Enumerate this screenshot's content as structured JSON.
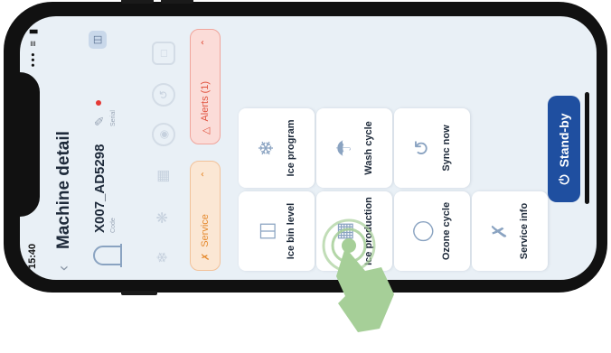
{
  "status_bar": {
    "time": "15:40",
    "icons": "••• ≡ ▮"
  },
  "header": {
    "back_icon": "chevron-left-icon",
    "title": "Machine detail"
  },
  "machine": {
    "code": "X007_AD5298",
    "code_caption": "Code",
    "serial_caption": "Serial",
    "device_icon": "device-icon"
  },
  "pills": {
    "service": "Service",
    "alerts": "Alerts (1)"
  },
  "tiles": [
    {
      "label": "Ice bin level"
    },
    {
      "label": "Ice production"
    },
    {
      "label": "Ozone cycle"
    },
    {
      "label": "Service info"
    },
    {
      "label": "Ice program"
    },
    {
      "label": "Wash cycle"
    },
    {
      "label": "Sync now"
    }
  ],
  "standby": {
    "label": "Stand-by"
  },
  "colors": {
    "accent": "#1f4fa0",
    "service": "#e58a2e",
    "alert": "#e0533f",
    "touch": "#a6cf98"
  }
}
